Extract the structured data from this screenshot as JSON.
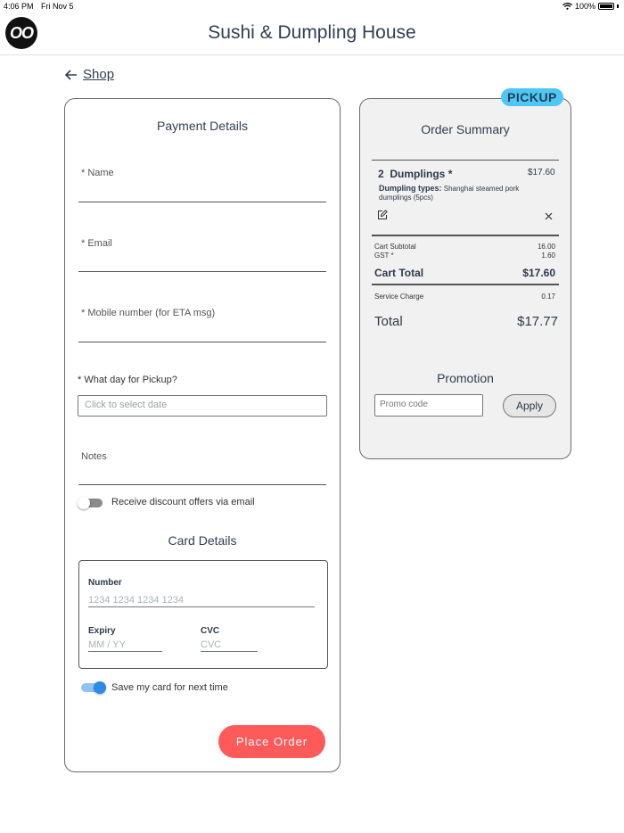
{
  "status_bar": {
    "time": "4:06 PM",
    "date": "Fri Nov 5",
    "battery": "100%"
  },
  "header": {
    "logo_text": "OO",
    "title": "Sushi & Dumpling House"
  },
  "nav": {
    "back_label": "Shop",
    "back_icon": "arrow-left-icon"
  },
  "payment": {
    "title": "Payment Details",
    "name_label": "* Name",
    "email_label": "* Email",
    "mobile_label": "* Mobile number (for ETA msg)",
    "pickup_day_label": "* What day for Pickup?",
    "date_placeholder": "Click to select date",
    "notes_label": "Notes",
    "discount_toggle_label": "Receive discount offers via email",
    "discount_toggle_on": false
  },
  "card": {
    "title": "Card Details",
    "number_label": "Number",
    "number_placeholder": "1234 1234 1234 1234",
    "expiry_label": "Expiry",
    "expiry_placeholder": "MM / YY",
    "cvc_label": "CVC",
    "cvc_placeholder": "CVC",
    "save_toggle_label": "Save my card for next time",
    "save_toggle_on": true
  },
  "place_order": {
    "label": "Place Order",
    "color": "#ff5a5a"
  },
  "summary": {
    "badge": "PICKUP",
    "title": "Order Summary",
    "item": {
      "qty": "2",
      "name": "Dumplings *",
      "price": "$17.60",
      "option_label": "Dumpling types:",
      "option_value": "Shanghai steamed pork dumplings (5pcs)"
    },
    "cart_subtotal_label": "Cart Subtotal",
    "cart_subtotal_value": "16.00",
    "gst_label": "GST *",
    "gst_value": "1.60",
    "cart_total_label": "Cart Total",
    "cart_total_value": "$17.60",
    "service_charge_label": "Service Charge",
    "service_charge_value": "0.17",
    "total_label": "Total",
    "total_value": "$17.77"
  },
  "promotion": {
    "title": "Promotion",
    "placeholder": "Promo code",
    "apply_label": "Apply"
  }
}
